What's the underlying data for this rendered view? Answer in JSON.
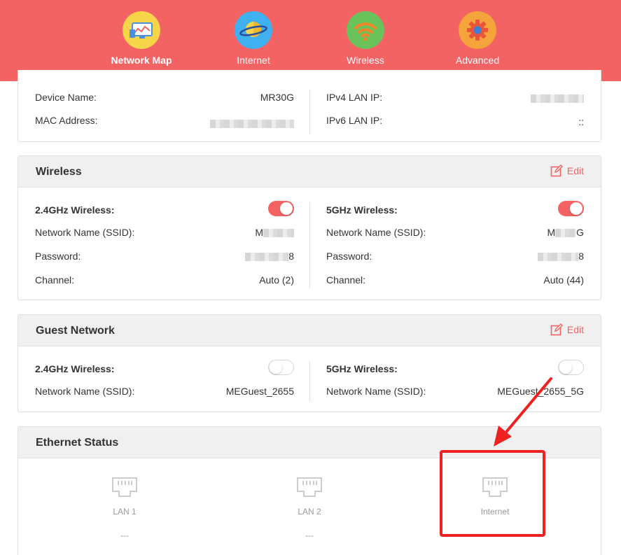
{
  "nav": {
    "items": [
      {
        "label": "Network Map",
        "icon": "network-map-icon",
        "active": true
      },
      {
        "label": "Internet",
        "icon": "internet-planet-icon",
        "active": false
      },
      {
        "label": "Wireless",
        "icon": "wifi-icon",
        "active": false
      },
      {
        "label": "Advanced",
        "icon": "gear-icon",
        "active": false
      }
    ]
  },
  "device": {
    "device_name_label": "Device Name:",
    "device_name": "MR30G",
    "mac_label": "MAC Address:",
    "ipv4_label": "IPv4 LAN IP:",
    "ipv6_label": "IPv6 LAN IP:",
    "ipv6_value": "::"
  },
  "wireless": {
    "title": "Wireless",
    "edit_label": "Edit",
    "band24": {
      "label": "2.4GHz Wireless:",
      "enabled": true,
      "ssid_label": "Network Name (SSID):",
      "ssid_visible": "M",
      "password_label": "Password:",
      "password_visible": "8",
      "channel_label": "Channel:",
      "channel": "Auto (2)"
    },
    "band5": {
      "label": "5GHz Wireless:",
      "enabled": true,
      "ssid_label": "Network Name (SSID):",
      "ssid_visible_start": "M",
      "ssid_visible_end": "G",
      "password_label": "Password:",
      "password_visible": "8",
      "channel_label": "Channel:",
      "channel": "Auto (44)"
    }
  },
  "guest": {
    "title": "Guest Network",
    "edit_label": "Edit",
    "band24": {
      "label": "2.4GHz Wireless:",
      "enabled": false,
      "ssid_label": "Network Name (SSID):",
      "ssid": "MEGuest_2655"
    },
    "band5": {
      "label": "5GHz Wireless:",
      "enabled": false,
      "ssid_label": "Network Name (SSID):",
      "ssid": "MEGuest_2655_5G"
    }
  },
  "ethernet": {
    "title": "Ethernet Status",
    "ports": [
      {
        "name": "LAN 1",
        "status": "---"
      },
      {
        "name": "LAN 2",
        "status": "---"
      },
      {
        "name": "Internet",
        "status": ""
      }
    ]
  },
  "colors": {
    "brand": "#f46363",
    "annotation": "#ee2020"
  }
}
